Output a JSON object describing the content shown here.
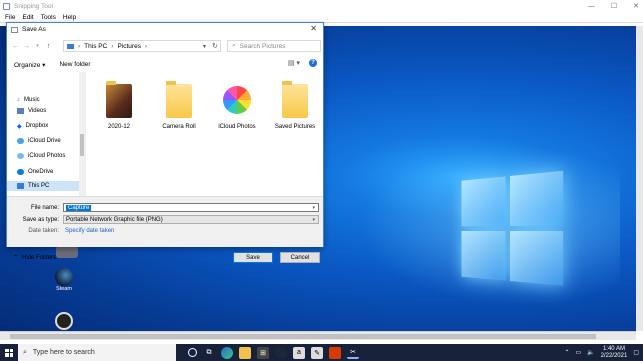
{
  "app": {
    "title": "Snipping Tool",
    "menu": [
      "File",
      "Edit",
      "Tools",
      "Help"
    ]
  },
  "dialog": {
    "title": "Save As",
    "breadcrumb": [
      "This PC",
      "Pictures"
    ],
    "search_placeholder": "Search Pictures",
    "commands": {
      "organize": "Organize ▾",
      "new_folder": "New folder"
    },
    "nav_items": [
      "Music",
      "Videos",
      "Dropbox",
      "iCloud Drive",
      "iCloud Photos",
      "OneDrive",
      "This PC"
    ],
    "files": [
      "2020-12",
      "Camera Roll",
      "iCloud Photos",
      "Saved Pictures"
    ],
    "file_name_label": "File name:",
    "file_name_value": "Capture",
    "save_type_label": "Save as type:",
    "save_type_value": "Portable Network Graphic file (PNG)",
    "date_label": "Date taken:",
    "date_link": "Specify date taken",
    "hide_folders": "Hide Folders",
    "save_button": "Save",
    "cancel_button": "Cancel"
  },
  "desktop": {
    "icons": [
      "Steam"
    ]
  },
  "taskbar": {
    "search_placeholder": "Type here to search",
    "time": "1:40 AM",
    "date": "2/22/2021"
  }
}
